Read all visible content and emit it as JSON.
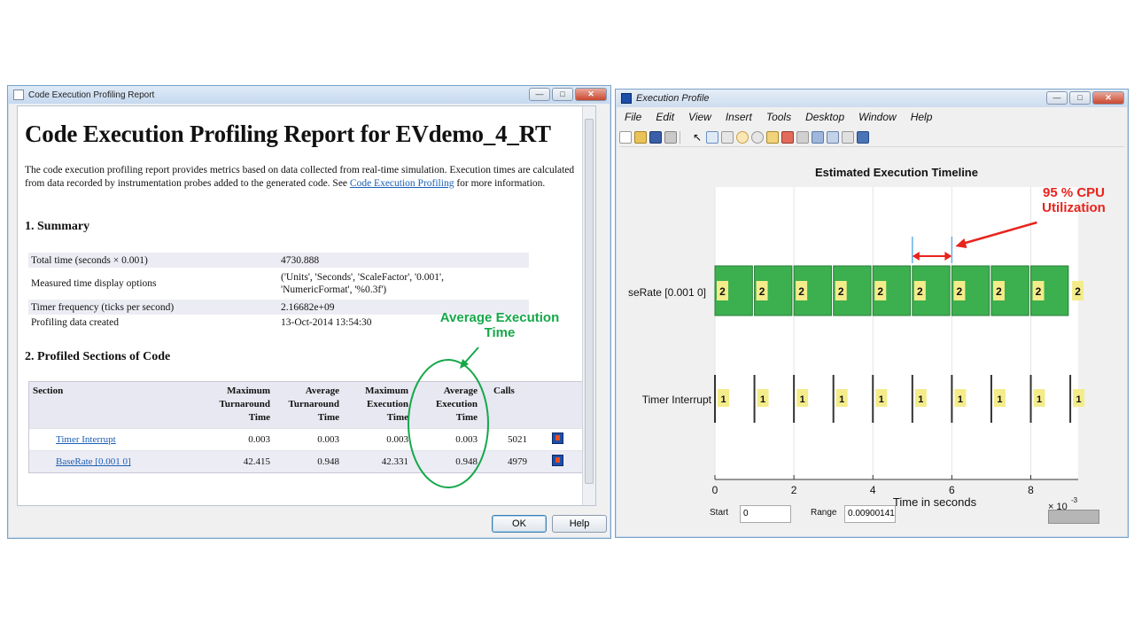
{
  "report_window": {
    "title": "Code Execution Profiling Report",
    "heading": "Code Execution Profiling Report for EVdemo_4_RT",
    "intro_text": "The code execution profiling report provides metrics based on data collected from real-time simulation. Execution times are calculated from data recorded by instrumentation probes added to the generated code. See ",
    "intro_link": "Code Execution Profiling",
    "intro_tail": " for more information.",
    "summary_heading": "1. Summary",
    "summary": [
      {
        "label": "Total time (seconds × 0.001)",
        "value": "4730.888"
      },
      {
        "label": "Measured time display options",
        "value": "('Units', 'Seconds', 'ScaleFactor', '0.001', 'NumericFormat', '%0.3f')"
      },
      {
        "label": "Timer frequency (ticks per second)",
        "value": "2.16682e+09"
      },
      {
        "label": "Profiling data created",
        "value": "13-Oct-2014 13:54:30"
      }
    ],
    "sections_heading": "2. Profiled Sections of Code",
    "columns": [
      "Section",
      "Maximum Turnaround Time",
      "Average Turnaround Time",
      "Maximum Execution Time",
      "Average Execution Time",
      "Calls"
    ],
    "rows": [
      {
        "section": "Timer Interrupt",
        "max_turnaround": "0.003",
        "avg_turnaround": "0.003",
        "max_exec": "0.003",
        "avg_exec": "0.003",
        "calls": "5021"
      },
      {
        "section": "BaseRate [0.001 0]",
        "max_turnaround": "42.415",
        "avg_turnaround": "0.948",
        "max_exec": "42.331",
        "avg_exec": "0.948",
        "calls": "4979"
      }
    ],
    "ok_label": "OK",
    "help_label": "Help"
  },
  "annotations": {
    "avg_exec_label": "Average Execution\nTime",
    "cpu_label": "95 % CPU\nUtilization",
    "green_color": "#15a84a",
    "red_color": "#e8231c"
  },
  "figure_window": {
    "title": "Execution Profile",
    "menus": [
      "File",
      "Edit",
      "View",
      "Insert",
      "Tools",
      "Desktop",
      "Window",
      "Help"
    ],
    "start_label": "Start",
    "start_value": "0",
    "range_label": "Range",
    "range_value": "0.00900141"
  },
  "chart_data": {
    "type": "timeline",
    "title": "Estimated Execution Timeline",
    "xlabel": "Time in seconds",
    "x_scale_label": "× 10",
    "x_scale_exponent": "-3",
    "xlim": [
      0,
      9.2
    ],
    "xticks": [
      "0",
      "2",
      "4",
      "6",
      "8"
    ],
    "xtick_values": [
      0,
      2,
      4,
      6,
      8
    ],
    "rows": [
      {
        "label": "seRate [0.001 0]",
        "task_label": "2",
        "color": "#3cb04e",
        "segments": [
          [
            0,
            0.95
          ],
          [
            1,
            1.95
          ],
          [
            2,
            2.95
          ],
          [
            3,
            3.95
          ],
          [
            4,
            4.95
          ],
          [
            5,
            5.95
          ],
          [
            6,
            6.95
          ],
          [
            7,
            7.95
          ],
          [
            8,
            8.95
          ]
        ]
      },
      {
        "label": "Timer Interrupt",
        "task_label": "1",
        "color": "#f4ec8a",
        "events": [
          0,
          1,
          2,
          3,
          4,
          5,
          6,
          7,
          8,
          9
        ]
      }
    ],
    "callout_interval": [
      5,
      6
    ]
  }
}
